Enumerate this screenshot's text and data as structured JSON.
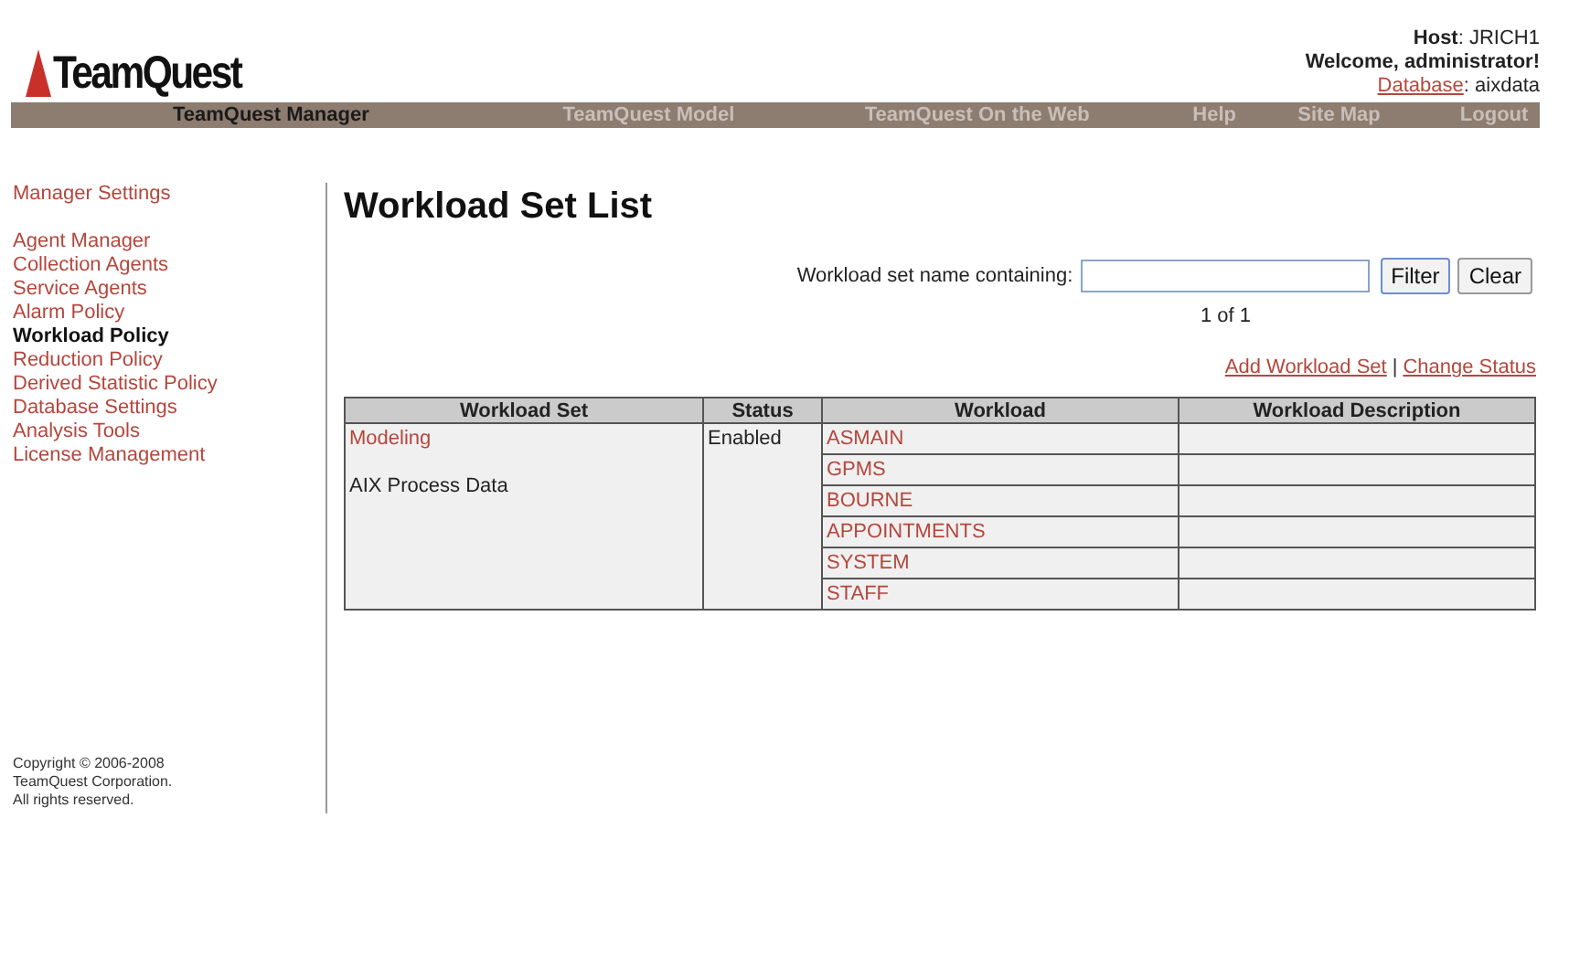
{
  "header": {
    "logo": "TeamQuest",
    "separator": ":",
    "host_label": "Host",
    "host": "JRICH1",
    "welcome": "Welcome, administrator!",
    "database_label": "Database",
    "database": "aixdata"
  },
  "nav": [
    {
      "label": "TeamQuest Manager",
      "selected": true
    },
    {
      "label": "TeamQuest Model",
      "selected": false
    },
    {
      "label": "TeamQuest On the Web",
      "selected": false
    },
    {
      "label": "Help",
      "selected": false
    },
    {
      "label": "Site Map",
      "selected": false
    },
    {
      "label": "Logout",
      "selected": false
    }
  ],
  "sidebar": {
    "heading": "Manager Settings",
    "items": [
      {
        "label": "Agent Manager",
        "selected": false
      },
      {
        "label": "Collection Agents",
        "selected": false
      },
      {
        "label": "Service Agents",
        "selected": false
      },
      {
        "label": "Alarm Policy",
        "selected": false
      },
      {
        "label": "Workload Policy",
        "selected": true
      },
      {
        "label": "Reduction Policy",
        "selected": false
      },
      {
        "label": "Derived Statistic Policy",
        "selected": false
      },
      {
        "label": "Database Settings",
        "selected": false
      },
      {
        "label": "Analysis Tools",
        "selected": false
      },
      {
        "label": "License Management",
        "selected": false
      }
    ],
    "copyright": [
      "Copyright © 2006-2008",
      "TeamQuest Corporation.",
      "All rights reserved."
    ]
  },
  "page_title": "Workload Set List",
  "filter": {
    "label": "Workload set name containing:",
    "buttons": [
      "Filter",
      "Clear"
    ],
    "pagination": "1 of 1"
  },
  "actions": [
    "Add Workload Set",
    "Change Status"
  ],
  "actions_separator": "|",
  "table": {
    "columns": [
      "Workload Set",
      "Status",
      "Workload",
      "Workload Description"
    ],
    "rows": [
      {
        "workload_set": "Modeling",
        "description": "AIX Process Data",
        "status": "Enabled",
        "workloads": [
          "ASMAIN",
          "GPMS",
          "BOURNE",
          "APPOINTMENTS",
          "SYSTEM",
          "STAFF"
        ]
      }
    ]
  }
}
